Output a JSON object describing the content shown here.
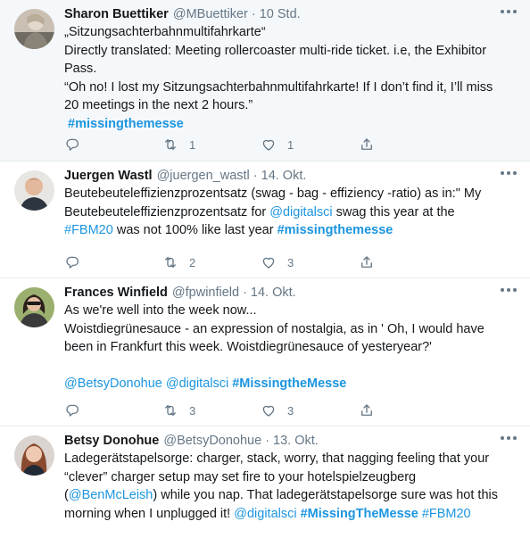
{
  "tweets": [
    {
      "name": "Sharon Buettiker",
      "handle": "@MBuettiker",
      "time": "10 Std.",
      "lines": [
        "„Sitzungsachterbahnmultifahrkarte“",
        "Directly translated: Meeting rollercoaster multi-ride ticket. i.e, the Exhibitor Pass.",
        "“Oh no! I lost my Sitzungsachterbahnmultifahrkarte! If I don’t find it, I’ll miss 20 meetings in the next 2 hours.”"
      ],
      "hashtag": "#missingthemesse",
      "replies": "",
      "retweets": "1",
      "likes": "1"
    },
    {
      "name": "Juergen Wastl",
      "handle": "@juergen_wastl",
      "time": "14. Okt.",
      "text_a": "Beutebeuteleffizienzprozentsatz (swag - bag - effiziency -ratio) as in:\" My Beutebeuteleffizienzprozentsatz for ",
      "mention": "@digitalsci",
      "text_b": " swag this year at the ",
      "tag1": "#FBM20",
      "text_c": " was not 100% like last year ",
      "tag2": "#missingthemesse",
      "replies": "",
      "retweets": "2",
      "likes": "3"
    },
    {
      "name": "Frances Winfield",
      "handle": "@fpwinfield",
      "time": "14. Okt.",
      "line1": "As we're well into the week now...",
      "line2": "Woistdiegrünesauce - an expression of nostalgia, as in ' Oh, I would have been in Frankfurt this week. Woistdiegrünesauce of yesteryear?'",
      "mention1": "@BetsyDonohue",
      "mention2": "@digitalsci",
      "hashtag": "#MissingtheMesse",
      "replies": "",
      "retweets": "3",
      "likes": "3"
    },
    {
      "name": "Betsy Donohue",
      "handle": "@BetsyDonohue",
      "time": "13. Okt.",
      "text_a": "Ladegerätstapelsorge: charger, stack, worry, that nagging feeling that your “clever” charger setup may set fire to your hotelspielzeugberg (",
      "mention1": "@BenMcLeish",
      "text_b": ") while you nap.  That ladegerätstapelsorge sure was hot this morning when I unplugged it! ",
      "mention2": "@digitalsci",
      "tag1": "#MissingTheMesse",
      "tag2": "#FBM20"
    }
  ],
  "separator_dot": "·",
  "colors": {
    "accent": "#1b95e0",
    "muted": "#657786",
    "text": "#14171a",
    "highlight_bg": "#f5f8fa"
  },
  "icons": [
    "reply-icon",
    "retweet-icon",
    "like-icon",
    "share-icon",
    "more-icon"
  ]
}
